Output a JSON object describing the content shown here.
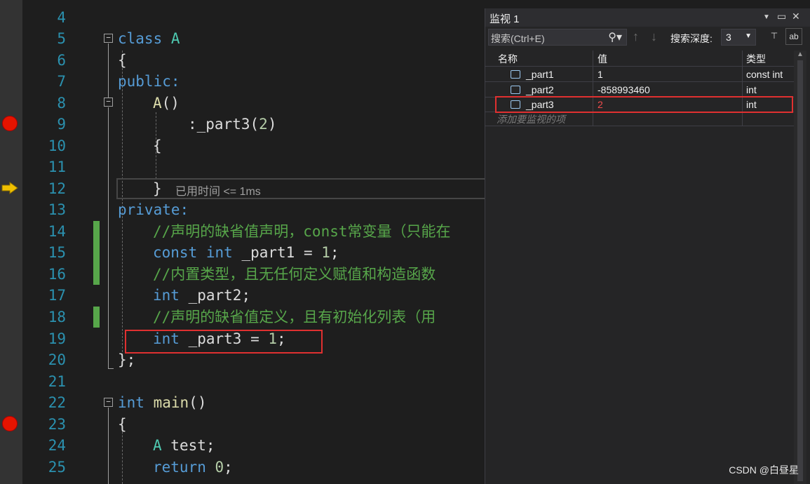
{
  "editor": {
    "line_numbers": [
      "4",
      "5",
      "6",
      "7",
      "8",
      "9",
      "10",
      "11",
      "12",
      "13",
      "14",
      "15",
      "16",
      "17",
      "18",
      "19",
      "20",
      "21",
      "22",
      "23",
      "24",
      "25"
    ],
    "code": {
      "l5_kw": "class",
      "l5_name": "A",
      "l6": "{",
      "l7": "public:",
      "l8_fn": "A",
      "l8_rest": "()",
      "l9_a": ":_part3(",
      "l9_num": "2",
      "l9_b": ")",
      "l10": "{",
      "l12": "}",
      "l13": "private:",
      "l14": "//声明的缺省值声明，const常变量（只能在",
      "l15_kw": "const",
      "l15_kw2": "int",
      "l15_rest": " _part1 = ",
      "l15_num": "1",
      "l15_end": ";",
      "l16": "//内置类型，且无任何定义赋值和构造函数",
      "l17_kw": "int",
      "l17_rest": " _part2;",
      "l18": "//声明的缺省值定义，且有初始化列表（用",
      "l19_kw": "int",
      "l19_rest": " _part3 = ",
      "l19_num": "1",
      "l19_end": ";",
      "l20": "};",
      "l22_kw": "int",
      "l22_fn": "main",
      "l22_rest": "()",
      "l23": "{",
      "l24_cls": "A",
      "l24_rest": " test;",
      "l25_kw": "return",
      "l25_num": "0",
      "l25_end": ";"
    },
    "elapsed_hint": "已用时间 <= 1ms",
    "fold_symbol": "−"
  },
  "watch": {
    "title": "监视 1",
    "search_placeholder": "搜索(Ctrl+E)",
    "search_depth_label": "搜索深度:",
    "search_depth_value": "3",
    "columns": {
      "name": "名称",
      "value": "值",
      "type": "类型"
    },
    "rows": [
      {
        "name": "_part1",
        "value": "1",
        "type": "const int",
        "changed": false
      },
      {
        "name": "_part2",
        "value": "-858993460",
        "type": "int",
        "changed": false
      },
      {
        "name": "_part3",
        "value": "2",
        "type": "int",
        "changed": true
      }
    ],
    "add_item": "添加要监视的项"
  },
  "watermark": "CSDN @白昼星",
  "colors": {
    "keyword": "#569cd6",
    "comment": "#57a64a",
    "line_number": "#2b91af",
    "breakpoint": "#e51400",
    "highlight_box": "#e03030"
  },
  "icons": [
    "breakpoint-icon",
    "current-line-arrow-icon",
    "fold-icon",
    "search-icon",
    "dropdown-icon",
    "up-arrow-icon",
    "down-arrow-icon",
    "pin-icon",
    "field-icon"
  ]
}
